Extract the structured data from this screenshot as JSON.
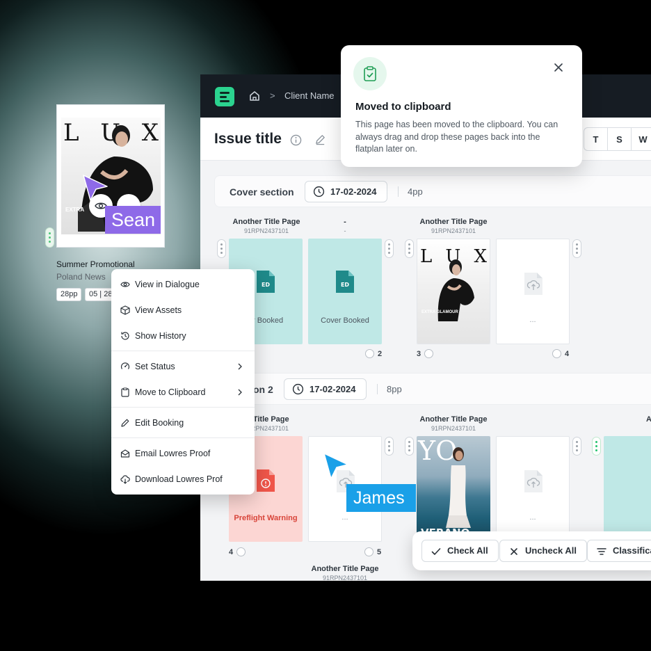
{
  "app": {
    "breadcrumb": {
      "separator": ">",
      "client": "Client Name"
    },
    "issue_title": "Issue title",
    "view_toggle": [
      "T",
      "S",
      "W"
    ]
  },
  "toast": {
    "title": "Moved to clipboard",
    "body": "This page has been moved to the clipboard. You can always drag and drop these pages back into the flatplan later on."
  },
  "sections": [
    {
      "name": "Cover section",
      "date": "17-02-2024",
      "pages": "4pp"
    },
    {
      "name": "on 2",
      "date": "17-02-2024",
      "pages": "8pp"
    }
  ],
  "section1": {
    "labels": [
      {
        "title": "Another Title Page",
        "code": "91RPN2437101"
      },
      {
        "title": "-",
        "code": "-"
      },
      {
        "title": "Another Title Page",
        "code": "91RPN2437101"
      }
    ],
    "pages": [
      {
        "caption": "er Booked",
        "badge": "ED"
      },
      {
        "caption": "Cover Booked",
        "badge": "ED"
      },
      {
        "cover_letters": [
          "L",
          "U",
          "X"
        ],
        "cover_tag": "EXTRA GLAMOUR"
      },
      {
        "caption": "..."
      }
    ],
    "numbers": [
      "2",
      "3",
      "4"
    ]
  },
  "section2": {
    "labels": [
      {
        "title": "er Title Page",
        "code": "91RPN2437101"
      },
      {
        "title": "Another Title Page",
        "code": "91RPN2437101"
      },
      {
        "title": "A",
        "code": ""
      }
    ],
    "pages": [
      {
        "caption": "Preflight Warning"
      },
      {
        "caption": "..."
      },
      {
        "cover_title": "YO",
        "cover_footer": "VERANO"
      },
      {
        "caption": "..."
      }
    ],
    "numbers": [
      "4",
      "5"
    ],
    "bottom_label": {
      "title": "Another Title Page",
      "code": "91RPN2437101"
    }
  },
  "card": {
    "cover_letters": [
      "L",
      "U",
      "X"
    ],
    "cover_tag": "EXTRA",
    "title": "Summer Promotional",
    "subtitle": "Poland News",
    "tags": [
      "28pp",
      "05 | 28"
    ]
  },
  "cursors": {
    "purple_name": "Sean",
    "blue_name": "James"
  },
  "context_menu": [
    "View in Dialogue",
    "View Assets",
    "Show History",
    "Set Status",
    "Move to Clipboard",
    "Edit Booking",
    "Email Lowres Proof",
    "Download Lowres Prof"
  ],
  "actions": {
    "check_all": "Check All",
    "uncheck_all": "Uncheck All",
    "classify": "Classifica"
  },
  "colors": {
    "accent_green": "#2bd38f",
    "teal_page": "#bfe8e6",
    "warning_page": "#fcd6d3",
    "warning_text": "#d8453a",
    "cursor_purple": "#8e6ae8",
    "cursor_blue": "#1aa0e8",
    "topbar": "#161c23"
  }
}
